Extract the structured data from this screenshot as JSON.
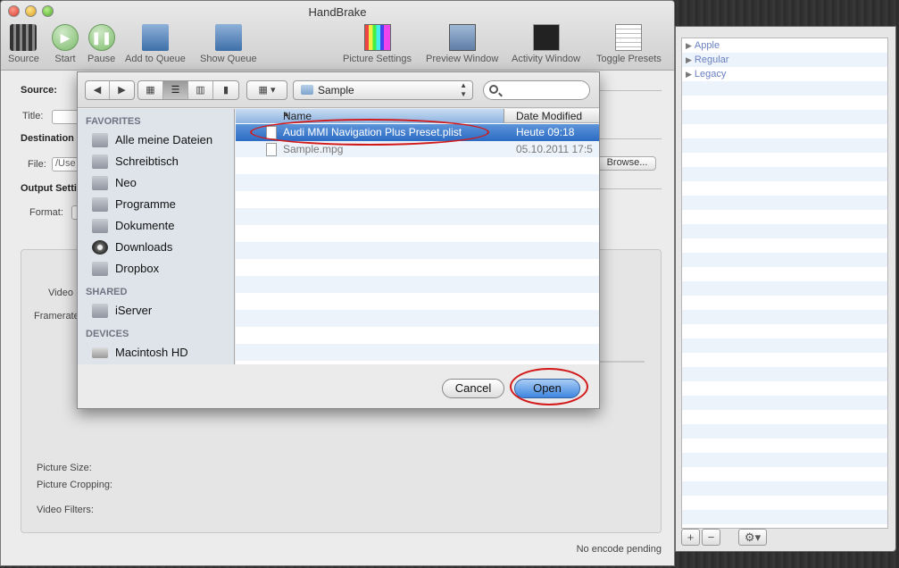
{
  "window": {
    "title": "HandBrake"
  },
  "toolbar": {
    "source": "Source",
    "start": "Start",
    "pause": "Pause",
    "add_to_queue": "Add to Queue",
    "show_queue": "Show Queue",
    "picture_settings": "Picture Settings",
    "preview_window": "Preview Window",
    "activity_window": "Activity Window",
    "toggle_presets": "Toggle Presets"
  },
  "main": {
    "source_label": "Source:",
    "title_label": "Title:",
    "destination_label": "Destination",
    "file_label": "File:",
    "file_value": "/Use",
    "browse": "Browse...",
    "output_label": "Output Setti",
    "format_label": "Format:",
    "video_label": "Video",
    "framerate_label": "Framerate",
    "picture_size": "Picture Size:",
    "picture_cropping": "Picture Cropping:",
    "video_filters": "Video Filters:",
    "status": "No encode pending"
  },
  "presets": {
    "items": [
      "Apple",
      "Regular",
      "Legacy"
    ]
  },
  "dialog": {
    "location": "Sample",
    "sidebar": {
      "favorites_header": "FAVORITES",
      "favorites": [
        "Alle meine Dateien",
        "Schreibtisch",
        "Neo",
        "Programme",
        "Dokumente",
        "Downloads",
        "Dropbox"
      ],
      "shared_header": "SHARED",
      "shared": [
        "iServer"
      ],
      "devices_header": "DEVICES",
      "devices": [
        "Macintosh HD"
      ]
    },
    "columns": {
      "name": "Name",
      "date": "Date Modified"
    },
    "files": [
      {
        "name": "Audi MMI Navigation Plus Preset.plist",
        "date": "Heute 09:18"
      },
      {
        "name": "Sample.mpg",
        "date": "05.10.2011 17:5"
      }
    ],
    "cancel": "Cancel",
    "open": "Open"
  },
  "colors": {
    "annotation_red": "#d21a1a",
    "selection_blue": "#2c6bc4"
  }
}
